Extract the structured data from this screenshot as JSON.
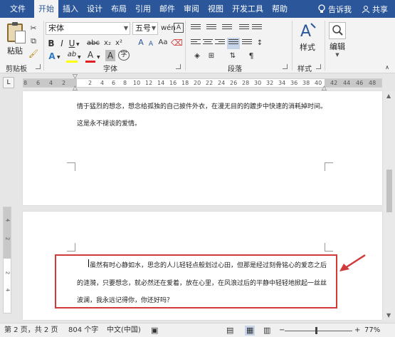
{
  "tabs": [
    {
      "label": "文件",
      "active": false
    },
    {
      "label": "开始",
      "active": true
    },
    {
      "label": "插入",
      "active": false
    },
    {
      "label": "设计",
      "active": false
    },
    {
      "label": "布局",
      "active": false
    },
    {
      "label": "引用",
      "active": false
    },
    {
      "label": "邮件",
      "active": false
    },
    {
      "label": "审阅",
      "active": false
    },
    {
      "label": "视图",
      "active": false
    },
    {
      "label": "开发工具",
      "active": false
    },
    {
      "label": "帮助",
      "active": false
    }
  ],
  "tell_me": "告诉我",
  "share": "共享",
  "ribbon": {
    "paste_label": "粘贴",
    "groups": {
      "clipboard": "剪贴板",
      "font": "字体",
      "paragraph": "段落",
      "styles": "样式"
    },
    "font_name": "宋体",
    "font_size": "五号",
    "font_size_glyph": "wén",
    "format_glyphs": {
      "bold": "B",
      "italic": "I",
      "underline": "U",
      "strike": "abc",
      "sub": "x₂",
      "sup": "x²",
      "effects": "A",
      "highlight": "ab",
      "color": "A",
      "aa": "Aa",
      "grow": "A",
      "shrink": "A",
      "clear": "A",
      "char_shading": "A"
    },
    "styles_label": "样式",
    "editing_label": "编辑",
    "colors": {
      "highlight": "#ffff00",
      "font_color": "#e02020",
      "tab_bar": "#2b579a",
      "accent": "#2b579a"
    }
  },
  "ruler": {
    "corner_glyph": "L",
    "ticks": [
      "8",
      "6",
      "4",
      "2",
      "2",
      "4",
      "6",
      "8",
      "10",
      "12",
      "14",
      "16",
      "18",
      "20",
      "22",
      "24",
      "26",
      "28",
      "30",
      "32",
      "34",
      "36",
      "38",
      "40",
      "42",
      "44",
      "46",
      "48"
    ]
  },
  "vruler_ticks": [
    "4",
    "2",
    "2",
    "4"
  ],
  "page1": {
    "line1": "情于猛烈的想念，想念给孤独的自己披件外衣，在漫无目的的踱步中快速的消耗掉时间。",
    "line2": "这是永不褪谈的爱情。"
  },
  "page2": {
    "line1": "虽然有时心静如水，思念的人儿轻轻点般划过心田，但那是经过刻骨铭心的爱恋之后",
    "line2": "的涟漪，只要想念，就必然还在爱着，放在心里，在风浪过后的平静中轻轻地掀起一丝丝",
    "line3": "波澜，我永远记得你，你还好吗？"
  },
  "status": {
    "page": "第 2 页，共 2 页",
    "words": "804 个字",
    "language": "中文(中国)",
    "zoom": "77%",
    "minus": "−",
    "plus": "+"
  }
}
